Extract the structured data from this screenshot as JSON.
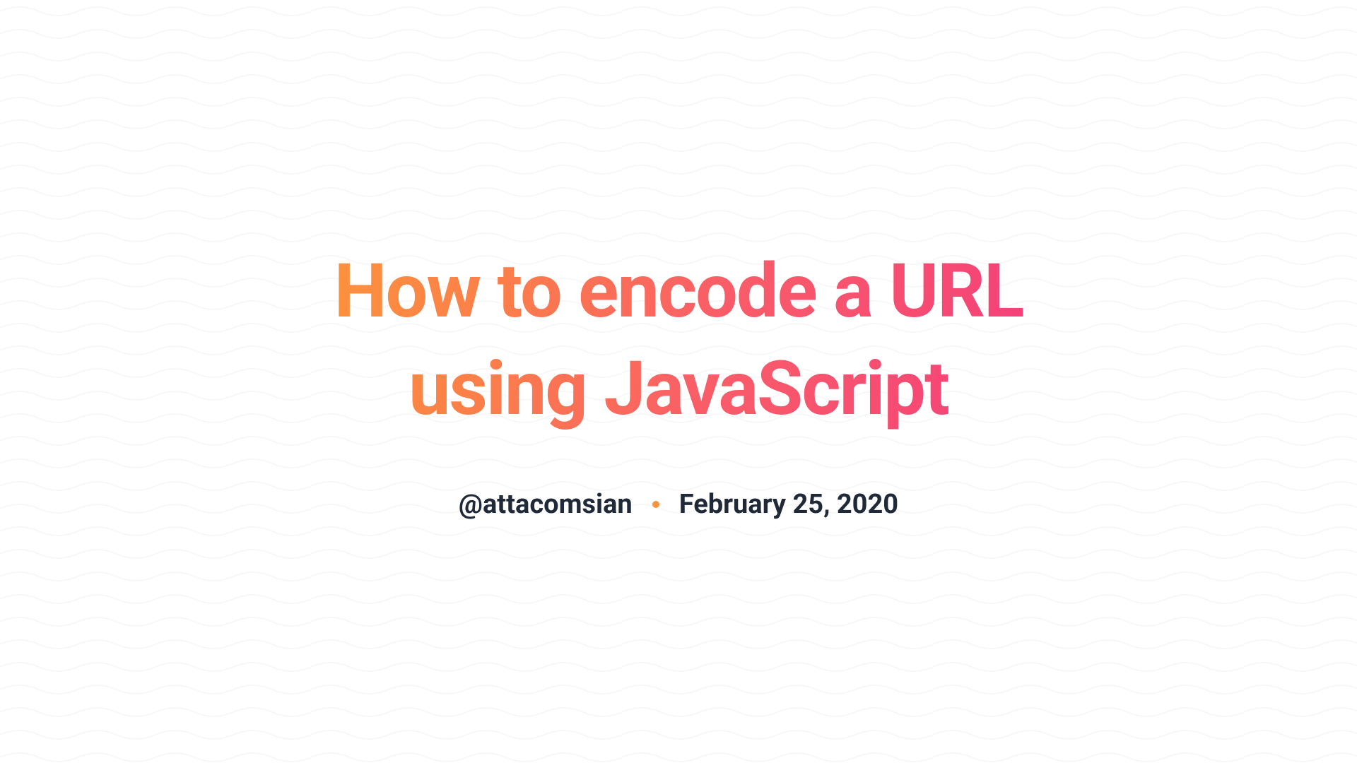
{
  "title": "How to encode a URL using JavaScript",
  "author": "@attacomsian",
  "date": "February 25, 2020",
  "colors": {
    "gradient_start": "#fb923c",
    "gradient_end": "#f43f7a",
    "text_dark": "#1f2937",
    "dot": "#fb923c",
    "wave": "#f3f4f6"
  }
}
